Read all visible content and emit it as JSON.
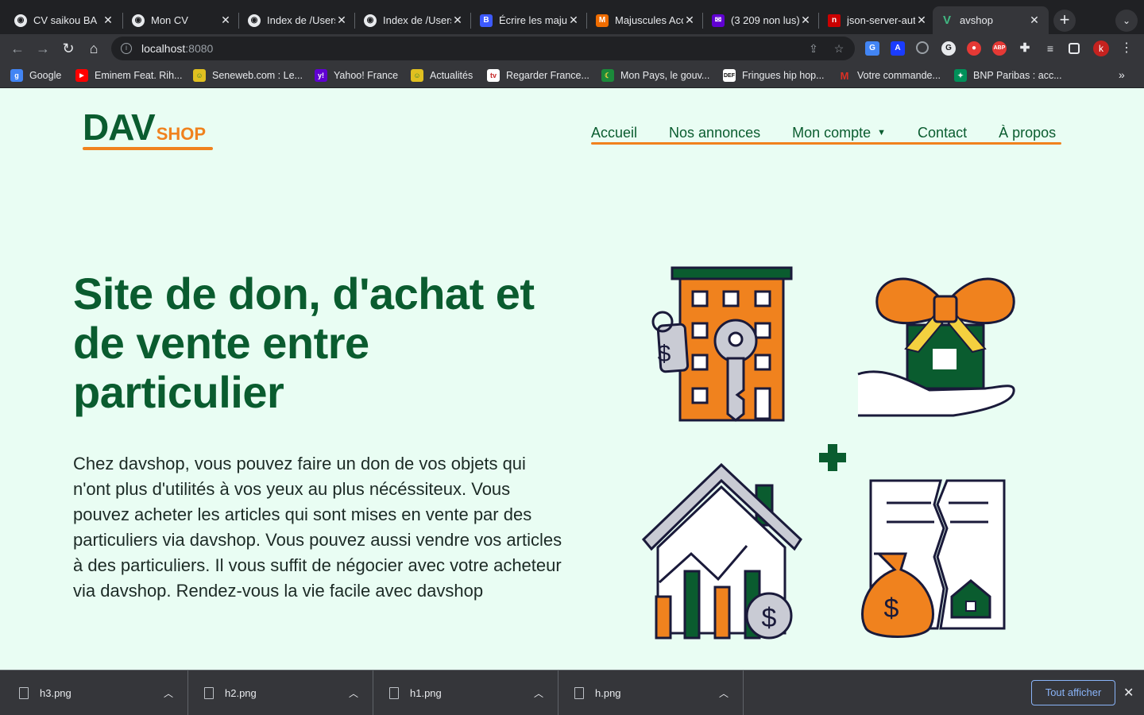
{
  "browser": {
    "tabs": [
      {
        "title": "CV saikou BA",
        "favicon": "globe-icon"
      },
      {
        "title": "Mon CV",
        "favicon": "globe-icon"
      },
      {
        "title": "Index de /Users/",
        "favicon": "globe-icon"
      },
      {
        "title": "Index de /Users/",
        "favicon": "globe-icon"
      },
      {
        "title": "Écrire les majuscules",
        "favicon": "site-icon"
      },
      {
        "title": "Majuscules Accentuées",
        "favicon": "site-icon"
      },
      {
        "title": "(3 209 non lus)",
        "favicon": "yahoo-mail-icon"
      },
      {
        "title": "json-server-auth",
        "favicon": "npm-icon"
      },
      {
        "title": "avshop",
        "favicon": "vue-icon",
        "active": true
      }
    ],
    "url_host": "localhost",
    "url_port": ":8080",
    "profile_initial": "k",
    "bookmarks": [
      {
        "label": "Google",
        "icon": "google-icon",
        "color": "#4285f4"
      },
      {
        "label": "Eminem Feat. Rih...",
        "icon": "youtube-icon",
        "color": "#ff0000"
      },
      {
        "label": "Seneweb.com : Le...",
        "icon": "seneweb-icon",
        "color": "#2e7d32"
      },
      {
        "label": "Yahoo! France",
        "icon": "yahoo-icon",
        "color": "#6001d2"
      },
      {
        "label": "Actualités",
        "icon": "seneweb-icon",
        "color": "#2e7d32"
      },
      {
        "label": "Regarder France...",
        "icon": "tv-icon",
        "color": "#c62828"
      },
      {
        "label": "Mon Pays, le gouv...",
        "icon": "flag-icon",
        "color": "#1b8a3a"
      },
      {
        "label": "Fringues hip hop...",
        "icon": "def-icon",
        "color": "#111111"
      },
      {
        "label": "Votre commande...",
        "icon": "gmail-icon",
        "color": "#d93025"
      },
      {
        "label": "BNP Paribas : acc...",
        "icon": "bnp-icon",
        "color": "#00915a"
      }
    ]
  },
  "site": {
    "logo_main": "DAV",
    "logo_sub": "SHOP",
    "nav": [
      {
        "label": "Accueil"
      },
      {
        "label": "Nos annonces"
      },
      {
        "label": "Mon compte",
        "dropdown": true
      },
      {
        "label": "Contact"
      },
      {
        "label": "À propos"
      }
    ],
    "hero_title": "Site de don, d'achat et de vente entre particulier",
    "hero_text": "Chez davshop, vous pouvez faire un don de vos objets qui n'ont plus d'utilités à vos yeux au plus nécéssiteux. Vous pouvez acheter les articles qui sont mises en vente par des particuliers via davshop. Vous pouvez aussi vendre vos articles à des particuliers. Il vous suffit de négocier avec votre acheteur via davshop. Rendez-vous la vie facile avec davshop",
    "colors": {
      "brand_green": "#0a5c2f",
      "accent_orange": "#f0821e",
      "background": "#e9fdf3"
    }
  },
  "downloads": {
    "items": [
      {
        "name": "h3.png"
      },
      {
        "name": "h2.png"
      },
      {
        "name": "h1.png"
      },
      {
        "name": "h.png"
      }
    ],
    "show_all_label": "Tout afficher"
  }
}
